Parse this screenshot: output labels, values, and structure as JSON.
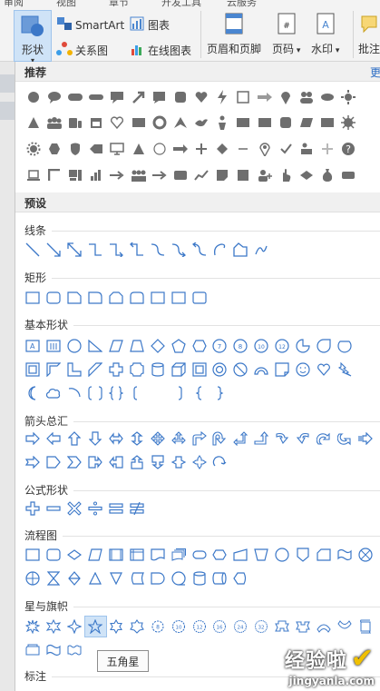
{
  "ribbon": {
    "tabs": [
      "审阅",
      "视图",
      "章节",
      "开发工具",
      "云服务"
    ],
    "shape_label": "形状",
    "smartart_label": "SmartArt",
    "chart_label": "图表",
    "relation_label": "关系图",
    "online_chart_label": "在线图表",
    "header_footer_label": "页眉和页脚",
    "page_number_label": "页码",
    "watermark_label": "水印",
    "comment_label": "批注"
  },
  "panel": {
    "recommended_title": "推荐",
    "more_label": "更",
    "presets_title": "预设",
    "sections": {
      "lines": "线条",
      "rectangles": "矩形",
      "basic": "基本形状",
      "arrows": "箭头总汇",
      "equation": "公式形状",
      "flowchart": "流程图",
      "stars": "星与旗帜",
      "callouts": "标注"
    },
    "tooltip": "五角星"
  },
  "watermark": {
    "line1": "经验啦",
    "line2": "jingyanla.com"
  },
  "colors": {
    "gray_shape": "#6e6e6e",
    "blue_shape": "#3c78c8",
    "selected_bg": "#cfe3f7",
    "link": "#2b6cc4"
  }
}
